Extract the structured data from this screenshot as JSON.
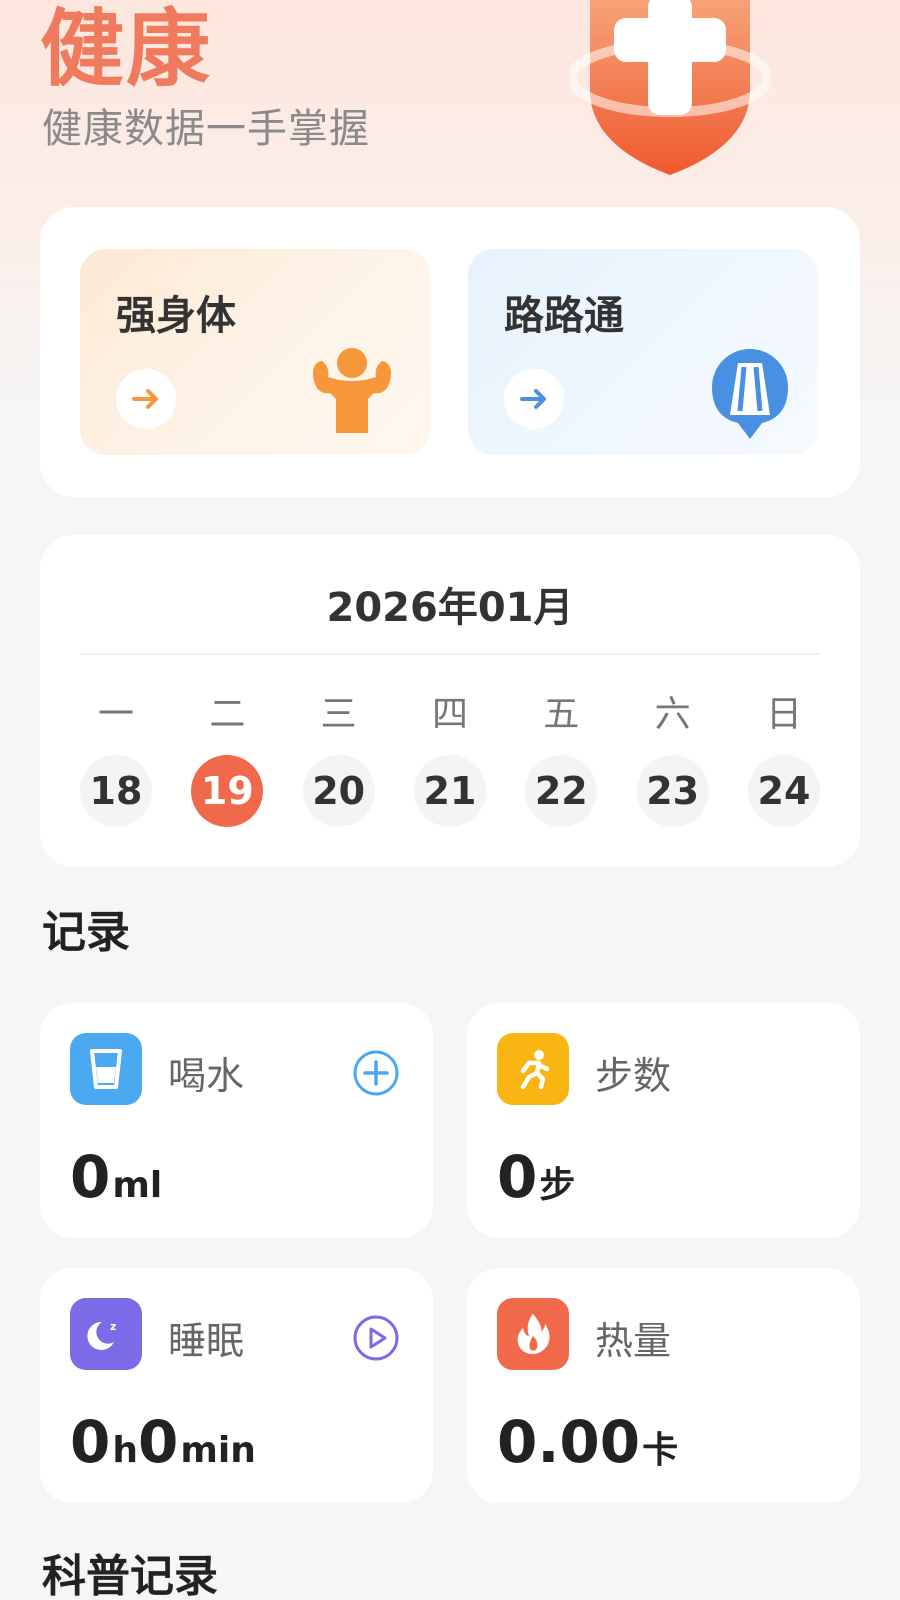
{
  "header": {
    "title": "健康",
    "subtitle": "健康数据一手掌握",
    "badge_icon": "medical-shield-icon",
    "colors": {
      "title": "#f07a5e"
    }
  },
  "features": [
    {
      "label": "强身体",
      "icon": "muscle-icon",
      "accent": "#f5973a"
    },
    {
      "label": "路路通",
      "icon": "road-pin-icon",
      "accent": "#4a90e2"
    }
  ],
  "calendar": {
    "month": "2026年01月",
    "weekdays": [
      "一",
      "二",
      "三",
      "四",
      "五",
      "六",
      "日"
    ],
    "days": [
      "18",
      "19",
      "20",
      "21",
      "22",
      "23",
      "24"
    ],
    "selected_day": "19",
    "accent": "#f0694a"
  },
  "records": {
    "title": "记录",
    "water": {
      "label": "喝水",
      "value": "0",
      "unit": "ml",
      "icon": "water-glass-icon",
      "action_icon": "add-circle-icon",
      "color": "#4aa9f0"
    },
    "steps": {
      "label": "步数",
      "value": "0",
      "unit": "步",
      "icon": "running-icon",
      "color": "#f9b511"
    },
    "sleep": {
      "label": "睡眠",
      "value1": "0",
      "unit1": "h",
      "value2": "0",
      "unit2": "min",
      "icon": "moon-icon",
      "action_icon": "play-circle-icon",
      "color": "#7b6be6"
    },
    "calories": {
      "label": "热量",
      "value": "0.00",
      "unit": "卡",
      "icon": "flame-icon",
      "color": "#f0694a"
    }
  },
  "science": {
    "title": "科普记录"
  }
}
